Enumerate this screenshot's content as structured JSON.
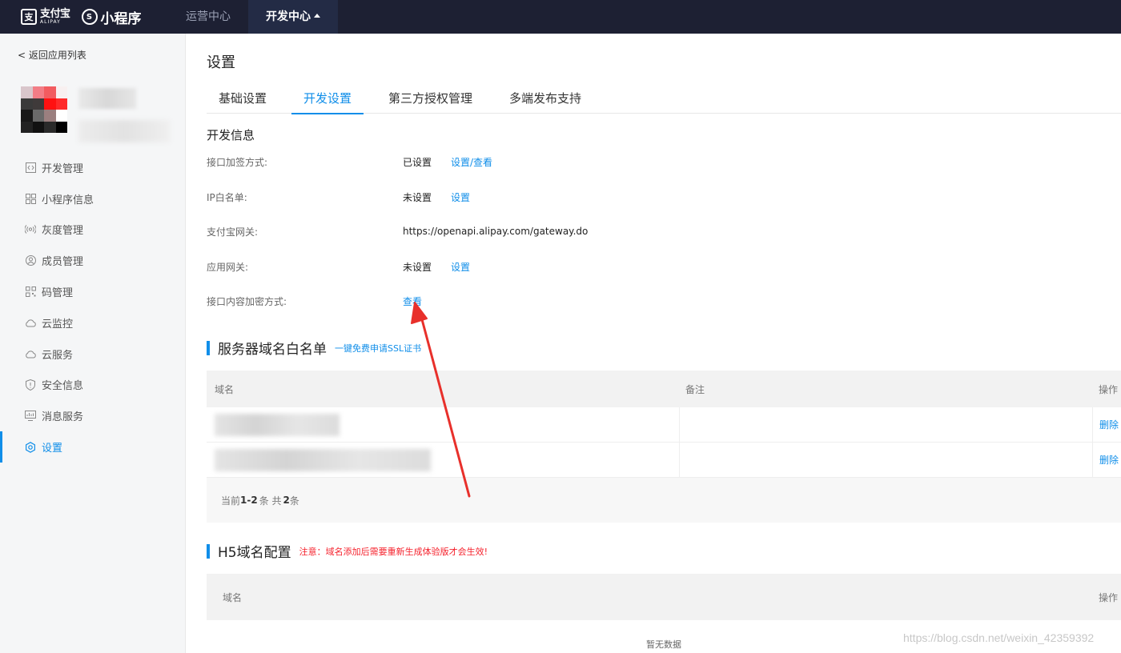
{
  "topbar": {
    "alipay_cn": "支付宝",
    "alipay_en": "ALIPAY",
    "product": "小程序",
    "nav": [
      {
        "label": "运营中心"
      },
      {
        "label": "开发中心"
      }
    ]
  },
  "sidebar": {
    "back_link": "< 返回应用列表",
    "items": [
      {
        "label": "开发管理",
        "icon": "code-icon"
      },
      {
        "label": "小程序信息",
        "icon": "grid-icon"
      },
      {
        "label": "灰度管理",
        "icon": "broadcast-icon"
      },
      {
        "label": "成员管理",
        "icon": "user-icon"
      },
      {
        "label": "码管理",
        "icon": "qrcode-icon"
      },
      {
        "label": "云监控",
        "icon": "cloud-icon"
      },
      {
        "label": "云服务",
        "icon": "cloud-icon"
      },
      {
        "label": "安全信息",
        "icon": "shield-icon"
      },
      {
        "label": "消息服务",
        "icon": "message-icon"
      },
      {
        "label": "设置",
        "icon": "gear-icon"
      }
    ],
    "accent": "#108ee9"
  },
  "main": {
    "title": "设置",
    "tabs": [
      {
        "label": "基础设置"
      },
      {
        "label": "开发设置"
      },
      {
        "label": "第三方授权管理"
      },
      {
        "label": "多端发布支持"
      }
    ],
    "dev_info": {
      "title": "开发信息",
      "rows": [
        {
          "label": "接口加签方式:",
          "value": "已设置",
          "link": "设置/查看"
        },
        {
          "label": "IP白名单:",
          "value": "未设置",
          "link": "设置"
        },
        {
          "label": "支付宝网关:",
          "value": "https://openapi.alipay.com/gateway.do"
        },
        {
          "label": "应用网关:",
          "value": "未设置",
          "link": "设置"
        },
        {
          "label": "接口内容加密方式:",
          "link": "查看"
        }
      ]
    },
    "server_whitelist": {
      "title": "服务器域名白名单",
      "ssl_link": "一键免费申请SSL证书",
      "columns": [
        "域名",
        "备注",
        "操作"
      ],
      "rows": [
        {
          "action": "删除"
        },
        {
          "action": "删除"
        }
      ],
      "pager": {
        "prefix": "当前",
        "range": "1-2",
        "mid": "条 共",
        "total": "2",
        "suffix": "条"
      }
    },
    "h5_domain": {
      "title": "H5域名配置",
      "warning": "注意：域名添加后需要重新生成体验版才会生效!",
      "columns": [
        "域名",
        "操作"
      ],
      "empty": "暂无数据"
    }
  },
  "watermark": "https://blog.csdn.net/weixin_42359392",
  "colors": {
    "topbar": "#1d2033",
    "link": "#108ee9",
    "warning": "#f5222d",
    "arrow": "#e8302b"
  }
}
